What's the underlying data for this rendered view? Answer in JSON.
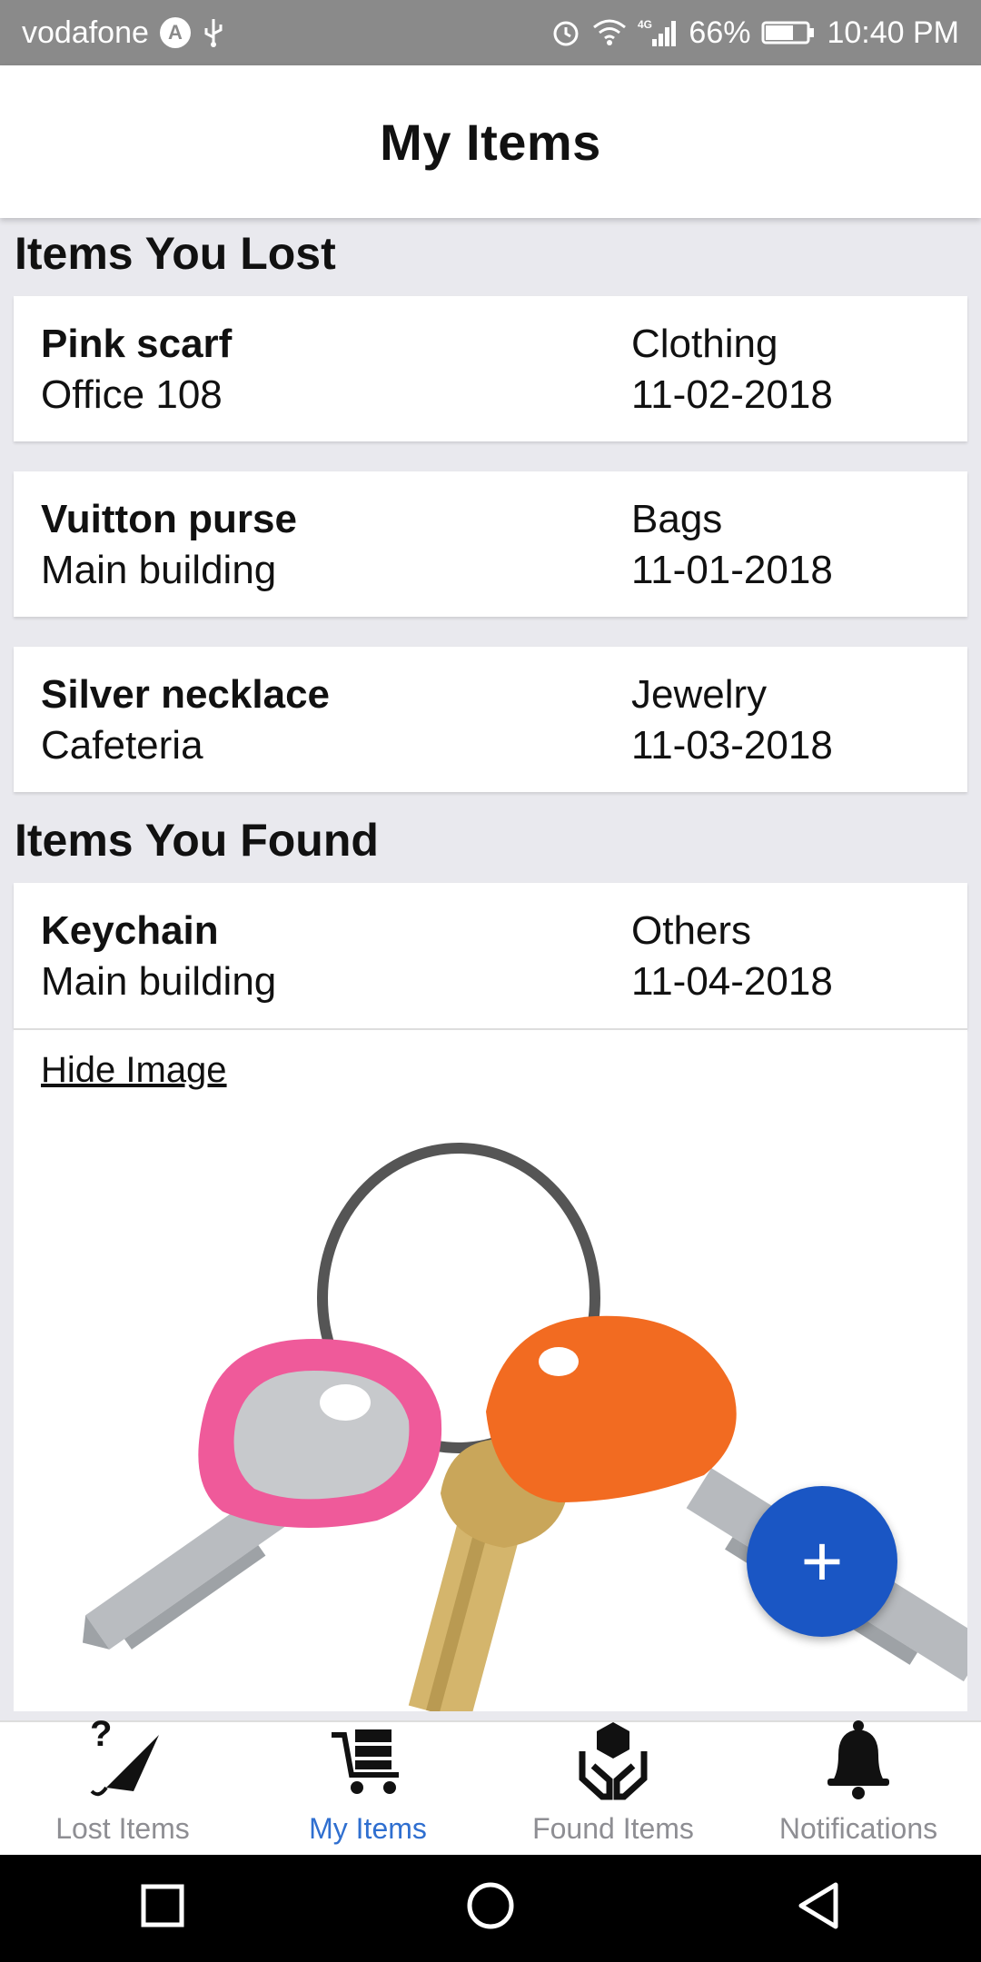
{
  "statusbar": {
    "carrier": "vodafone",
    "carrier_badge": "A",
    "battery": "66%",
    "time": "10:40 PM",
    "network": "4G"
  },
  "header": {
    "title": "My Items"
  },
  "lost_section": {
    "title": "Items You Lost",
    "items": [
      {
        "name": "Pink scarf",
        "location": "Office 108",
        "category": "Clothing",
        "date": "11-02-2018"
      },
      {
        "name": "Vuitton purse",
        "location": "Main building",
        "category": "Bags",
        "date": "11-01-2018"
      },
      {
        "name": "Silver necklace",
        "location": "Cafeteria",
        "category": "Jewelry",
        "date": "11-03-2018"
      }
    ]
  },
  "found_section": {
    "title": "Items You Found",
    "items": [
      {
        "name": "Keychain",
        "location": "Main building",
        "category": "Others",
        "date": "11-04-2018",
        "image_toggle": "Hide Image"
      }
    ]
  },
  "fab": {
    "icon": "plus-icon",
    "label": "+"
  },
  "tabs": [
    {
      "label": "Lost Items",
      "icon": "lost-umbrella-icon",
      "active": false
    },
    {
      "label": "My Items",
      "icon": "cart-icon",
      "active": true
    },
    {
      "label": "Found Items",
      "icon": "hands-box-icon",
      "active": false
    },
    {
      "label": "Notifications",
      "icon": "bell-icon",
      "active": false
    }
  ],
  "colors": {
    "accent": "#1a56c4",
    "active_tab": "#2f6fd0",
    "inactive_tab": "#8e8e93",
    "statusbar": "#8a8a8a"
  }
}
